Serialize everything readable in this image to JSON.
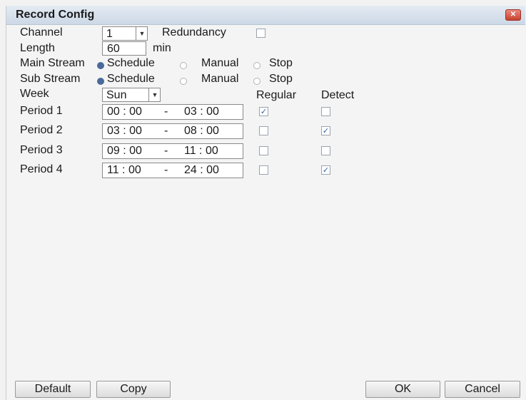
{
  "window": {
    "title": "Record Config",
    "close_glyph": "✕"
  },
  "form": {
    "channel_label": "Channel",
    "channel_value": "1",
    "redundancy_label": "Redundancy",
    "redundancy_checked": false,
    "length_label": "Length",
    "length_value": "60",
    "length_unit": "min",
    "main_stream_label": "Main Stream",
    "sub_stream_label": "Sub Stream",
    "mode_options": [
      "Schedule",
      "Manual",
      "Stop"
    ],
    "main_stream_selected": "Schedule",
    "sub_stream_selected": "Schedule",
    "week_label": "Week",
    "week_value": "Sun",
    "regular_header": "Regular",
    "detect_header": "Detect"
  },
  "periods": [
    {
      "label": "Period 1",
      "start": "00 : 00",
      "sep": "-",
      "end": "03 : 00",
      "regular": true,
      "detect": false
    },
    {
      "label": "Period 2",
      "start": "03 : 00",
      "sep": "-",
      "end": "08 : 00",
      "regular": false,
      "detect": true
    },
    {
      "label": "Period 3",
      "start": "09 : 00",
      "sep": "-",
      "end": "11 : 00",
      "regular": false,
      "detect": false
    },
    {
      "label": "Period 4",
      "start": "11 : 00",
      "sep": "-",
      "end": "24 : 00",
      "regular": false,
      "detect": true
    }
  ],
  "buttons": {
    "default": "Default",
    "copy": "Copy",
    "ok": "OK",
    "cancel": "Cancel"
  },
  "icons": {
    "dropdown": "chevron-down-icon",
    "check": "✓"
  }
}
